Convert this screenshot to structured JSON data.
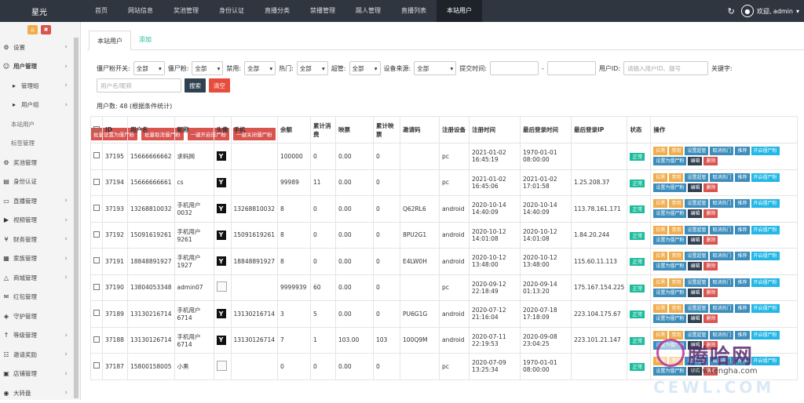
{
  "brand": "星光",
  "topnav": [
    "首页",
    "网站信息",
    "奖池管理",
    "身份认证",
    "直播分类",
    "禁播管理",
    "踢人管理",
    "直播列表",
    "本站用户"
  ],
  "user_label": "欢迎, admin",
  "sidebar": [
    {
      "label": "设置",
      "icon": "gears-icon",
      "arrow": true,
      "level": 0
    },
    {
      "label": "用户管理",
      "icon": "users-icon",
      "arrow": true,
      "level": 0,
      "bold": true
    },
    {
      "label": "管理组",
      "icon": "caret-right-icon",
      "arrow": true,
      "level": 1
    },
    {
      "label": "用户组",
      "icon": "caret-right-icon",
      "arrow": true,
      "level": 1
    },
    {
      "label": "本站用户",
      "icon": "",
      "arrow": false,
      "level": 2
    },
    {
      "label": "标签管理",
      "icon": "",
      "arrow": false,
      "level": 2
    },
    {
      "label": "奖池管理",
      "icon": "gear-icon",
      "arrow": false,
      "level": 0
    },
    {
      "label": "身份认证",
      "icon": "id-card-icon",
      "arrow": false,
      "level": 0
    },
    {
      "label": "直播管理",
      "icon": "desktop-icon",
      "arrow": true,
      "level": 0
    },
    {
      "label": "视频管理",
      "icon": "video-icon",
      "arrow": true,
      "level": 0
    },
    {
      "label": "财务管理",
      "icon": "yen-icon",
      "arrow": true,
      "level": 0
    },
    {
      "label": "家族管理",
      "icon": "building-icon",
      "arrow": true,
      "level": 0
    },
    {
      "label": "商城管理",
      "icon": "bank-icon",
      "arrow": true,
      "level": 0
    },
    {
      "label": "红包管理",
      "icon": "envelope-icon",
      "arrow": false,
      "level": 0
    },
    {
      "label": "守护管理",
      "icon": "shield-icon",
      "arrow": false,
      "level": 0
    },
    {
      "label": "等级管理",
      "icon": "level-up-icon",
      "arrow": true,
      "level": 0
    },
    {
      "label": "邀请奖励",
      "icon": "sitemap-icon",
      "arrow": true,
      "level": 0
    },
    {
      "label": "店铺管理",
      "icon": "shop-icon",
      "arrow": true,
      "level": 0
    },
    {
      "label": "大转盘",
      "icon": "wheel-icon",
      "arrow": true,
      "level": 0
    }
  ],
  "tabs": {
    "active": "本站用户",
    "other": "添加"
  },
  "filters": {
    "zombie_switch_label": "僵尸粉开关:",
    "zombie_label": "僵尸粉:",
    "ban_label": "禁用:",
    "hot_label": "热门:",
    "super_label": "超管:",
    "source_label": "设备来源:",
    "regtime_label": "提交时间:",
    "uid_label": "用户ID:",
    "keyword_label": "关键字:",
    "all": "全部",
    "date_sep": "-",
    "uid_placeholder": "请输入用户ID、靓号",
    "keyword_placeholder": "用户名/昵称",
    "search_btn": "搜索",
    "clear_btn": "清空"
  },
  "count_text": "用户数: 48 (根据条件统计)",
  "batch_buttons": [
    "批量设置为僵尸粉",
    "批量取消僵尸粉",
    "一键开启僵尸粉",
    "一键关闭僵尸粉"
  ],
  "table": {
    "headers": [
      "ID",
      "用户名",
      "昵称",
      "头像",
      "手机",
      "余额",
      "累计消费",
      "映票",
      "累计映票",
      "邀请码",
      "注册设备",
      "注册时间",
      "最后登录时间",
      "最后登录IP",
      "状态",
      "操作"
    ],
    "rows": [
      {
        "id": "37195",
        "username": "15666666662",
        "nickname": "求码网",
        "avatar": "Y",
        "phone": "",
        "balance": "100000",
        "consume": "0",
        "votes": "0.00",
        "total_votes": "0",
        "invite": "",
        "device": "pc",
        "reg": "2021-01-02 16:45:19",
        "last": "1970-01-01 08:00:00",
        "ip": "",
        "status": "正常"
      },
      {
        "id": "37194",
        "username": "15666666661",
        "nickname": "cs",
        "avatar": "Y",
        "phone": "",
        "balance": "99989",
        "consume": "11",
        "votes": "0.00",
        "total_votes": "0",
        "invite": "",
        "device": "pc",
        "reg": "2021-01-02 16:45:06",
        "last": "2021-01-02 17:01:58",
        "ip": "1.25.208.37",
        "status": "正常"
      },
      {
        "id": "37193",
        "username": "13268810032",
        "nickname": "手机用户0032",
        "avatar": "Y",
        "phone": "13268810032",
        "balance": "8",
        "consume": "0",
        "votes": "0.00",
        "total_votes": "0",
        "invite": "Q62RL6",
        "device": "android",
        "reg": "2020-10-14 14:40:09",
        "last": "2020-10-14 14:40:09",
        "ip": "113.78.161.171",
        "status": "正常"
      },
      {
        "id": "37192",
        "username": "15091619261",
        "nickname": "手机用户9261",
        "avatar": "Y",
        "phone": "15091619261",
        "balance": "8",
        "consume": "0",
        "votes": "0.00",
        "total_votes": "0",
        "invite": "8PU2G1",
        "device": "android",
        "reg": "2020-10-12 14:01:08",
        "last": "2020-10-12 14:01:08",
        "ip": "1.84.20.244",
        "status": "正常"
      },
      {
        "id": "37191",
        "username": "18848891927",
        "nickname": "手机用户1927",
        "avatar": "Y",
        "phone": "18848891927",
        "balance": "8",
        "consume": "0",
        "votes": "0.00",
        "total_votes": "0",
        "invite": "E4LW0H",
        "device": "android",
        "reg": "2020-10-12 13:48:00",
        "last": "2020-10-12 13:48:00",
        "ip": "115.60.11.113",
        "status": "正常"
      },
      {
        "id": "37190",
        "username": "13804053348",
        "nickname": "admin07",
        "avatar": "",
        "phone": "",
        "balance": "9999939",
        "consume": "60",
        "votes": "0.00",
        "total_votes": "0",
        "invite": "",
        "device": "pc",
        "reg": "2020-09-12 22:18:49",
        "last": "2020-09-14 01:13:20",
        "ip": "175.167.154.225",
        "status": "正常"
      },
      {
        "id": "37189",
        "username": "13130216714",
        "nickname": "手机用户6714",
        "avatar": "Y",
        "phone": "13130216714",
        "balance": "3",
        "consume": "5",
        "votes": "0.00",
        "total_votes": "0",
        "invite": "PU6G1G",
        "device": "android",
        "reg": "2020-07-12 21:16:04",
        "last": "2020-07-18 17:18:09",
        "ip": "223.104.175.67",
        "status": "正常"
      },
      {
        "id": "37188",
        "username": "13130126714",
        "nickname": "手机用户6714",
        "avatar": "Y",
        "phone": "13130126714",
        "balance": "7",
        "consume": "1",
        "votes": "103.00",
        "total_votes": "103",
        "invite": "100Q9M",
        "device": "android",
        "reg": "2020-07-11 22:19:53",
        "last": "2020-09-08 23:04:25",
        "ip": "223.101.21.147",
        "status": "正常"
      },
      {
        "id": "37187",
        "username": "15800158005",
        "nickname": "小黑",
        "avatar": "",
        "phone": "",
        "balance": "0",
        "consume": "0",
        "votes": "0.00",
        "total_votes": "0",
        "invite": "",
        "device": "pc",
        "reg": "2020-07-09 13:25:34",
        "last": "1970-01-01 08:00:00",
        "ip": "",
        "status": "正常"
      }
    ],
    "ops": [
      {
        "label": "拉黑",
        "color": "orange"
      },
      {
        "label": "禁用",
        "color": "orange"
      },
      {
        "label": "设置超管",
        "color": "blue"
      },
      {
        "label": "取消热门",
        "color": "blue"
      },
      {
        "label": "推荐",
        "color": "blue"
      },
      {
        "label": "开启僵尸粉",
        "color": "teal"
      },
      {
        "label": "设置为僵尸粉",
        "color": "blue"
      },
      {
        "label": "编辑",
        "color": "dark"
      },
      {
        "label": "删除",
        "color": "red"
      }
    ]
  },
  "watermark": {
    "title": "腾哈网",
    "domain": "www.tengha.com",
    "faint": "CEWL.COM"
  }
}
